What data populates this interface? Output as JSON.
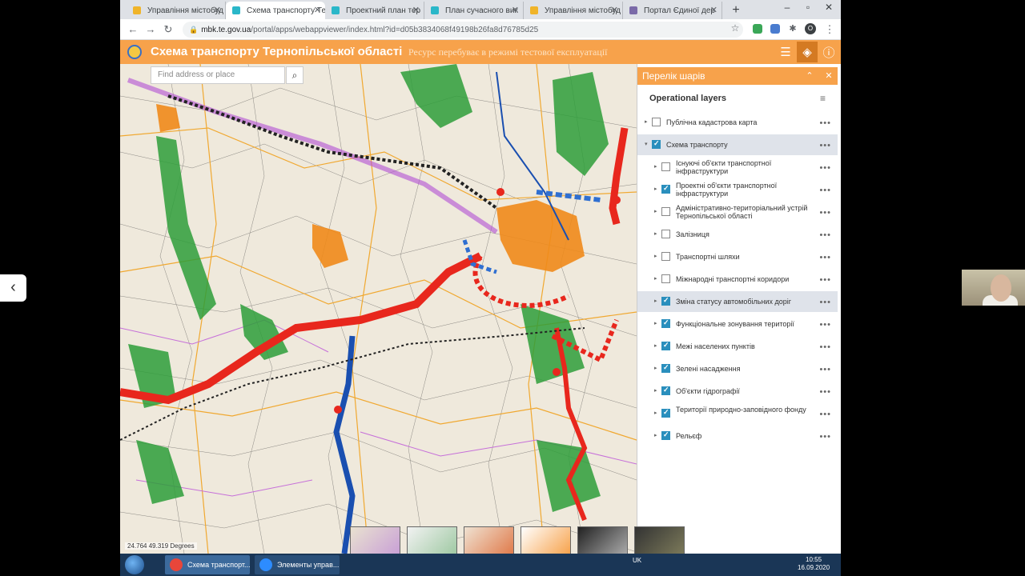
{
  "browser": {
    "tabs": [
      {
        "title": "Управління містобуд",
        "active": false,
        "color": "#f0b429"
      },
      {
        "title": "Схема транспорту Те",
        "active": true,
        "color": "#2ab7c9"
      },
      {
        "title": "Проектний план тер",
        "active": false,
        "color": "#2ab7c9"
      },
      {
        "title": "План сучасного вик",
        "active": false,
        "color": "#2ab7c9"
      },
      {
        "title": "Управління містобуд",
        "active": false,
        "color": "#f0b429"
      },
      {
        "title": "Портал Єдиної дер",
        "active": false,
        "color": "#7a6aa8"
      }
    ],
    "new_tab": "+",
    "url_domain": "mbk.te.gov.ua",
    "url_path": "/portal/apps/webappviewer/index.html?id=d05b3834068f49198b26fa8d76785d25",
    "profile_initial": "O"
  },
  "app": {
    "title": "Схема транспорту Тернопільської області",
    "subtitle": "Ресурс перебуває в режимі тестової експлуатації"
  },
  "map": {
    "search_placeholder": "Find address or place",
    "coords": "24.764 49.319 Degrees"
  },
  "layers_panel": {
    "title": "Перелік шарів",
    "section": "Operational layers",
    "layers": [
      {
        "label": "Публічна кадастрова карта",
        "checked": false,
        "level": 0,
        "highlight": false
      },
      {
        "label": "Схема транспорту",
        "checked": true,
        "level": 0,
        "highlight": true
      },
      {
        "label": "Існуючі об'єкти транспортної інфраструктури",
        "checked": false,
        "level": 1,
        "highlight": false
      },
      {
        "label": "Проектні об'єкти транспортної інфраструктури",
        "checked": true,
        "level": 1,
        "highlight": false
      },
      {
        "label": "Адміністративно-територіальний устрій Тернопільської області",
        "checked": false,
        "level": 1,
        "highlight": false
      },
      {
        "label": "Залізниця",
        "checked": false,
        "level": 1,
        "highlight": false
      },
      {
        "label": "Транспортні шляхи",
        "checked": false,
        "level": 1,
        "highlight": false
      },
      {
        "label": "Міжнародні транспортні коридори",
        "checked": false,
        "level": 1,
        "highlight": false
      },
      {
        "label": "Зміна статусу автомобільних доріг",
        "checked": true,
        "level": 1,
        "highlight": true
      },
      {
        "label": "Функціональне зонування території",
        "checked": true,
        "level": 1,
        "highlight": false
      },
      {
        "label": "Межі населених пунктів",
        "checked": true,
        "level": 1,
        "highlight": false
      },
      {
        "label": "Зелені насадження",
        "checked": true,
        "level": 1,
        "highlight": false
      },
      {
        "label": "Об'єкти гідрографії",
        "checked": true,
        "level": 1,
        "highlight": false
      },
      {
        "label": "Території природно-заповідного фонду",
        "checked": true,
        "level": 1,
        "highlight": false
      },
      {
        "label": "Рельєф",
        "checked": true,
        "level": 1,
        "highlight": false
      }
    ]
  },
  "taskbar": {
    "items": [
      {
        "label": "Схема транспорт...",
        "color": "#e8463a"
      },
      {
        "label": "Элементы управ...",
        "color": "#2d8cff"
      }
    ],
    "lang": "UK",
    "time": "10:55",
    "date": "16.09.2020"
  },
  "colors": {
    "header": "#f7a24b",
    "checkbox_on": "#2a8fbd",
    "road_red": "#e8271d",
    "river_blue": "#1a4fb0"
  }
}
